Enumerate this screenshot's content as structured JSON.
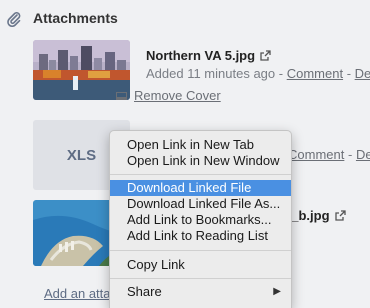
{
  "section": {
    "title": "Attachments",
    "icon": "paperclip-icon"
  },
  "attachments": [
    {
      "name": "Northern VA 5.jpg",
      "added": "Added 11 minutes ago -",
      "comment": "Comment",
      "delete": "Dele",
      "remove_cover": "Remove Cover"
    },
    {
      "thumb_label": "XLS",
      "name_partial": "",
      "comment": "Comment",
      "delete": "Dele"
    },
    {
      "name_partial": "c_b.jpg"
    }
  ],
  "add_attachment": "Add an atta",
  "context_menu": {
    "items": [
      {
        "label": "Open Link in New Tab"
      },
      {
        "label": "Open Link in New Window"
      },
      {
        "label": "Download Linked File",
        "highlighted": true
      },
      {
        "label": "Download Linked File As..."
      },
      {
        "label": "Add Link to Bookmarks..."
      },
      {
        "label": "Add Link to Reading List"
      },
      {
        "label": "Copy Link"
      },
      {
        "label": "Share",
        "submenu_arrow": "▶"
      }
    ]
  },
  "colors": {
    "highlight": "#4a90e2",
    "link": "#6b6f76",
    "background": "#f0f1f3"
  }
}
